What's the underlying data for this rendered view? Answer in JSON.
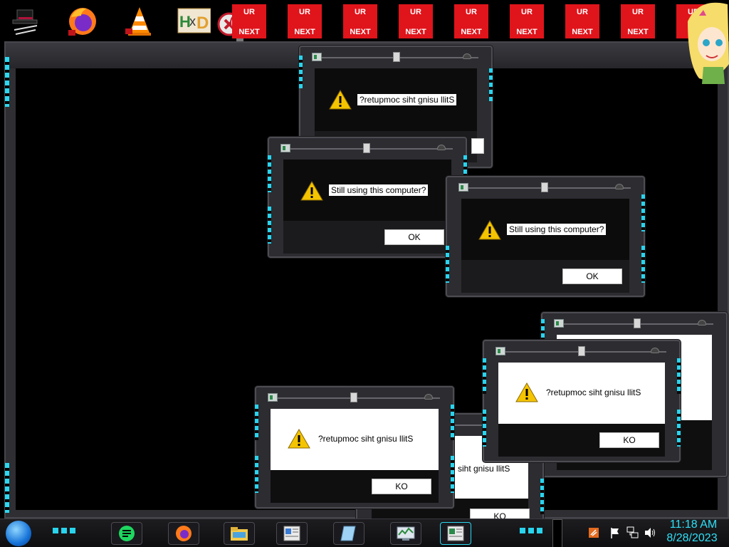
{
  "desktop": {
    "tiles": [
      {
        "line1": "UR",
        "line2": "NEXT"
      },
      {
        "line1": "UR",
        "line2": "NEXT"
      },
      {
        "line1": "UR",
        "line2": "NEXT"
      },
      {
        "line1": "UR",
        "line2": "NEXT"
      },
      {
        "line1": "UR",
        "line2": "NEXT"
      },
      {
        "line1": "UR",
        "line2": "NEXT"
      },
      {
        "line1": "UR",
        "line2": "NEXT"
      },
      {
        "line1": "UR",
        "line2": "NEXT"
      },
      {
        "line1": "UR",
        "line2": "NE"
      }
    ],
    "icons": [
      "top-hat-icon",
      "firefox-icon",
      "vlc-cone-icon",
      "hxd-hex-editor-icon",
      "error-x-icon",
      "anime-avatar-icon"
    ]
  },
  "dialogs": [
    {
      "message": "?retupmoc siht gnisu llitS",
      "button": ""
    },
    {
      "message": "Still using this computer?",
      "button": "OK"
    },
    {
      "message": "Still using this computer?",
      "button": "OK"
    },
    {
      "message": "",
      "button": ""
    },
    {
      "message": "?retupmoc siht gnisu llitS",
      "button": "KO"
    },
    {
      "message": "siht gnisu llitS",
      "button": "KO"
    },
    {
      "message": "?retupmoc siht gnisu llitS",
      "button": "KO"
    }
  ],
  "taskbar": {
    "start_icon": "start-orb-icon",
    "apps": [
      "notes-app-icon",
      "firefox-icon",
      "file-explorer-icon",
      "document-viewer-icon",
      "notepad-icon",
      "task-manager-icon",
      "control-panel-icon"
    ],
    "tray": [
      "network-warning-icon",
      "flag-icon",
      "network-icon",
      "speaker-icon"
    ],
    "time": "11:18 AM",
    "date": "8/28/2023"
  },
  "colors": {
    "accent_cyan": "#2ad8f0",
    "tile_red": "#e0141b",
    "frame_gray": "#2e2e33"
  }
}
